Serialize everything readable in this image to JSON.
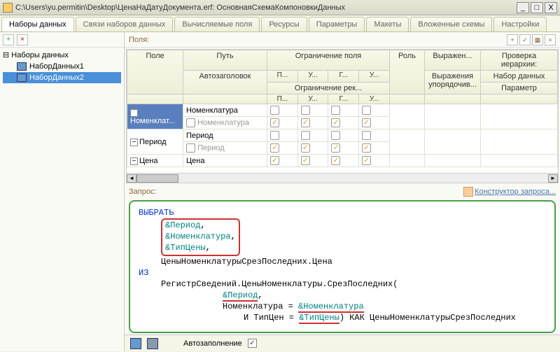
{
  "window": {
    "title": "C:\\Users\\yu.permitin\\Desktop\\ЦенаНаДатуДокумента.erf: ОсновнаяСхемаКомпоновкиДанных",
    "min": "_",
    "max": "□",
    "close": "X"
  },
  "tabs": [
    "Наборы данных",
    "Связи наборов данных",
    "Вычисляемые поля",
    "Ресурсы",
    "Параметры",
    "Макеты",
    "Вложенные схемы",
    "Настройки"
  ],
  "active_tab": 0,
  "tree": {
    "root": "Наборы данных",
    "items": [
      "НаборДанных1",
      "НаборДанных2"
    ],
    "selected": 1
  },
  "fields_label": "Поля:",
  "grid": {
    "headers": {
      "field": "Поле",
      "path": "Путь",
      "auto": "Автозаголовок",
      "restr_field": "Ограничение поля",
      "restr_rec": "Ограничение рек...",
      "p": "П...",
      "u": "У...",
      "g": "Г...",
      "u2": "У...",
      "role": "Роль",
      "expr": "Выражен...",
      "expr_ord": "Выражения упорядочив...",
      "hier": "Проверка иерархии:",
      "ds": "Набор данных",
      "param": "Параметр"
    },
    "rows": [
      {
        "field": "Номенклат...",
        "path": "Номенклатура",
        "auto": "Номенклатура",
        "checks": [
          true,
          true,
          true,
          true
        ]
      },
      {
        "field": "Период",
        "path": "Период",
        "auto": "Период",
        "checks": [
          true,
          true,
          true,
          true
        ]
      },
      {
        "field": "Цена",
        "path": "Цена",
        "auto": "",
        "checks": [
          true,
          true,
          true,
          true
        ]
      }
    ]
  },
  "query_label": "Запрос:",
  "constructor_label": "Конструктор запроса...",
  "code": {
    "l1": "ВЫБРАТЬ",
    "l2a": "&Период",
    "l2b": ",",
    "l3a": "&Номенклатура",
    "l3b": ",",
    "l4a": "&ТипЦены",
    "l4b": ",",
    "l5": "ЦеныНоменклатурыСрезПоследних.Цена",
    "l6": "ИЗ",
    "l7": "РегистрСведений.ЦеныНоменклатуры.СрезПоследних(",
    "l8a": "&Период",
    "l8b": ",",
    "l9a": "Номенклатура = ",
    "l9b": "&Номенклатура",
    "l10a": "И ТипЦен = ",
    "l10b": "&ТипЦены",
    "l10c": ") КАК ЦеныНоменклатурыСрезПоследних"
  },
  "autofill_label": "Автозаполнение"
}
